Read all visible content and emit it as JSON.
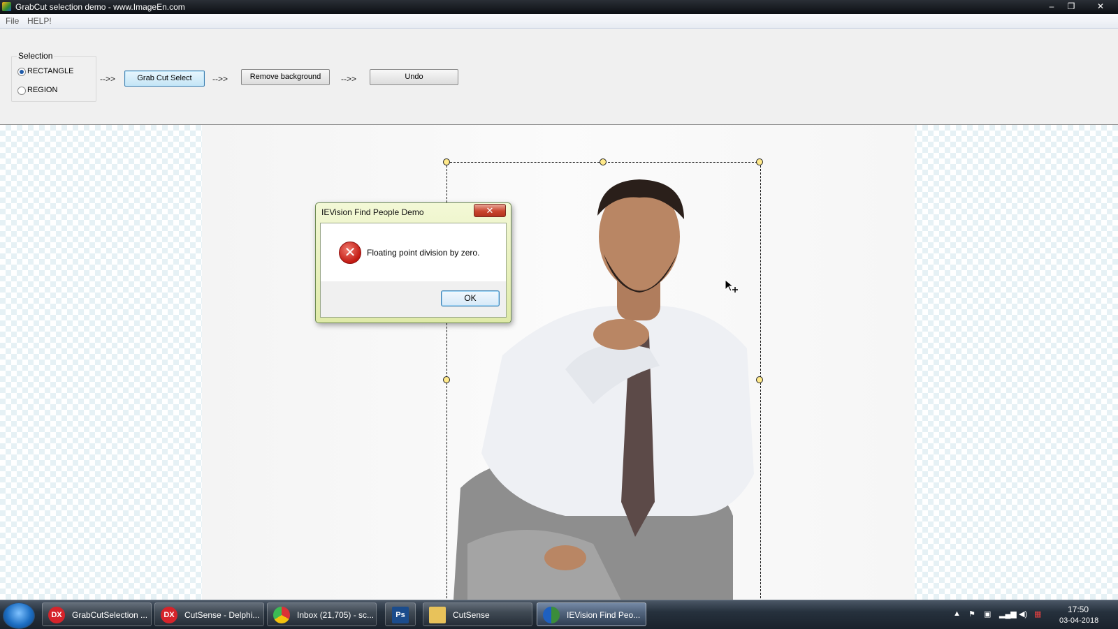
{
  "window": {
    "title": "GrabCut selection demo - www.ImageEn.com",
    "controls": {
      "minimize": "–",
      "maximize": "❐",
      "close": "✕"
    }
  },
  "menu": {
    "items": [
      "File",
      "HELP!"
    ]
  },
  "toolbar": {
    "selection_legend": "Selection",
    "radio_rectangle": "RECTANGLE",
    "radio_region": "REGION",
    "selected_mode": "RECTANGLE",
    "arrow": "-->>",
    "grab_cut_button": "Grab Cut Select",
    "remove_background_button": "Remove background",
    "undo_button": "Undo"
  },
  "dialog": {
    "title": "IEVision Find People Demo",
    "close": "✕",
    "message": "Floating point division by zero.",
    "ok_button": "OK",
    "icon": "error-icon"
  },
  "taskbar": {
    "items": [
      {
        "label": "GrabCutSelection ...",
        "icon": "DX",
        "color": "#d6242b",
        "active": false
      },
      {
        "label": "CutSense - Delphi...",
        "icon": "DX",
        "color": "#d6242b",
        "active": false
      },
      {
        "label": "Inbox (21,705) - sc...",
        "icon": "chrome-icon",
        "color": "#3b8d3b",
        "active": false
      },
      {
        "label": "",
        "icon": "Ps",
        "color": "#1b4c8c",
        "active": false
      },
      {
        "label": "CutSense",
        "icon": "folder-icon",
        "color": "#e8c25a",
        "active": false
      },
      {
        "label": "IEVision Find Peo...",
        "icon": "app-icon",
        "color": "#3b8d3b",
        "active": true
      }
    ],
    "clock_time": "17:50",
    "clock_date": "03-04-2018"
  },
  "colors": {
    "accent": "#3c7fb1",
    "error": "#c21a12",
    "titlebar": "#0c0f13"
  }
}
